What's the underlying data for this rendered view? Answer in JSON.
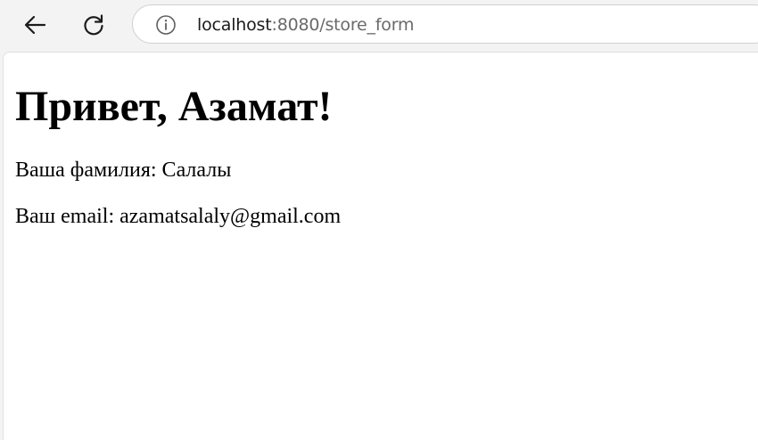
{
  "browser": {
    "url_host": "localhost",
    "url_rest": ":8080/store_form"
  },
  "page": {
    "greeting": "Привет, Азамат!",
    "surname_line": "Ваша фамилия: Салалы",
    "email_line": "Ваш email: azamatsalaly@gmail.com"
  }
}
